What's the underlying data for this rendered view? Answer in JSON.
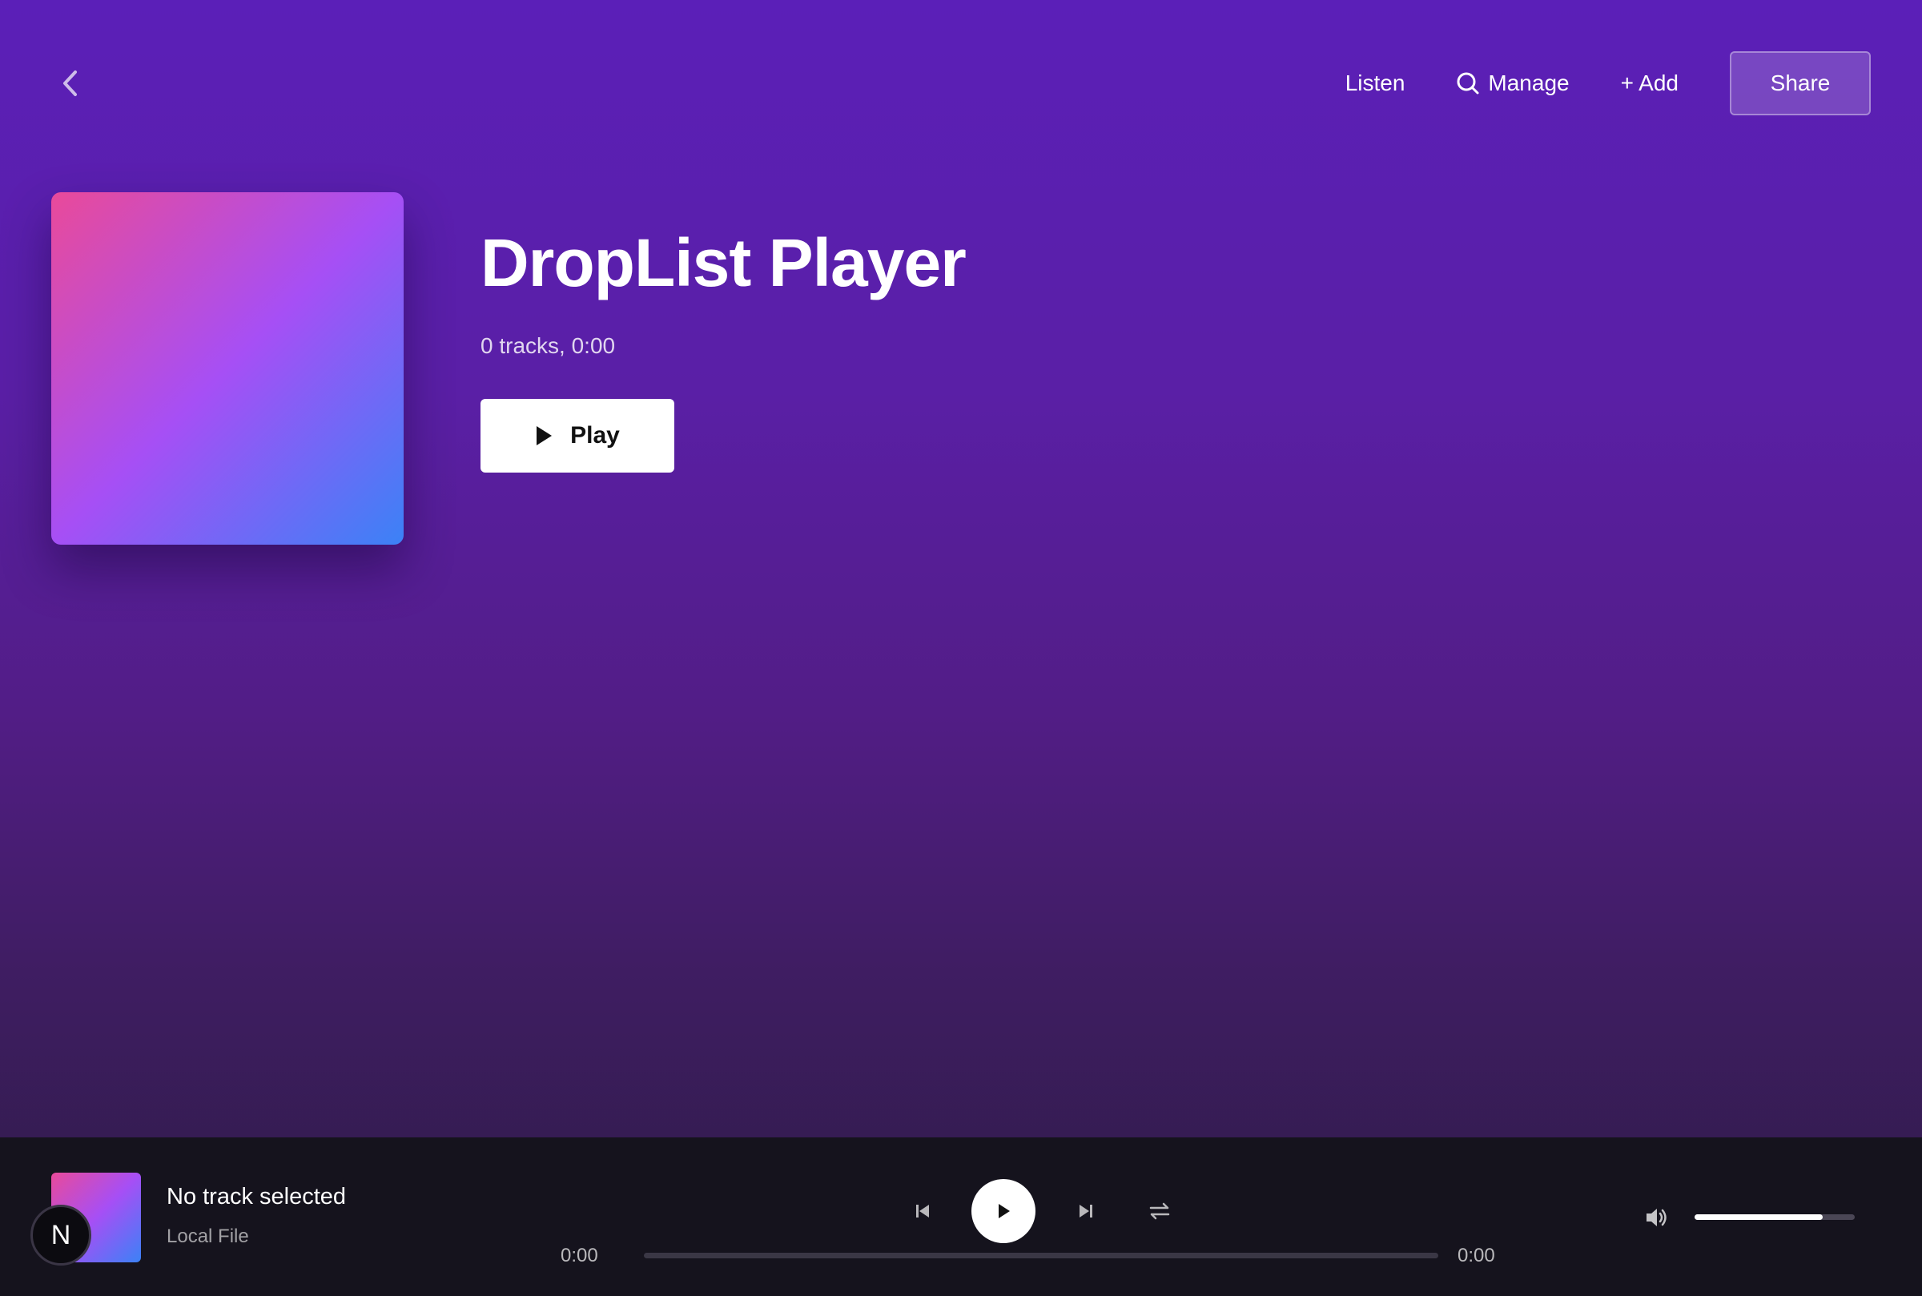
{
  "nav": {
    "links": [
      {
        "label": "Listen",
        "icon": ""
      },
      {
        "label": "Manage",
        "icon": "search-icon"
      },
      {
        "label": "+ Add",
        "icon": ""
      }
    ],
    "share_label": "Share"
  },
  "playlist": {
    "title": "DropList Player",
    "meta": "0 tracks, 0:00",
    "play_label": "Play"
  },
  "player": {
    "track_title": "No track selected",
    "track_source": "Local File",
    "time_current": "0:00",
    "time_total": "0:00",
    "progress": 0,
    "volume": 0.8,
    "badge_letter": "N"
  },
  "colors": {
    "background_top": "#5b1fb8",
    "background_bottom": "#2d1c46",
    "player_bar": "#15131d",
    "cover_gradient": [
      "#e94a9a",
      "#a64ff5",
      "#3b82f6"
    ]
  }
}
